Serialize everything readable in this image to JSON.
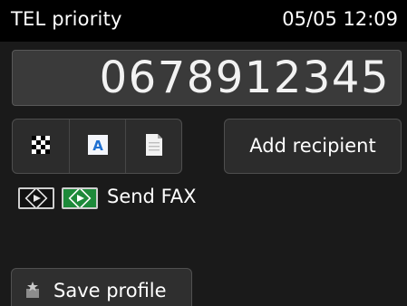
{
  "header": {
    "mode": "TEL priority",
    "datetime": "05/05 12:09"
  },
  "number_display": {
    "value": "0678912345"
  },
  "settings_icons": [
    {
      "icon": "resolution-icon"
    },
    {
      "icon": "scan-contrast-icon"
    },
    {
      "icon": "document-icon"
    }
  ],
  "buttons": {
    "add_recipient": "Add recipient",
    "save_profile": "Save profile"
  },
  "send_hint": {
    "label": "Send FAX",
    "icons": [
      "black-start-key-icon",
      "color-start-key-icon"
    ]
  },
  "colors": {
    "background": "#1a1a1a",
    "status_bar": "#000000",
    "color_start": "#1d8a3a"
  }
}
